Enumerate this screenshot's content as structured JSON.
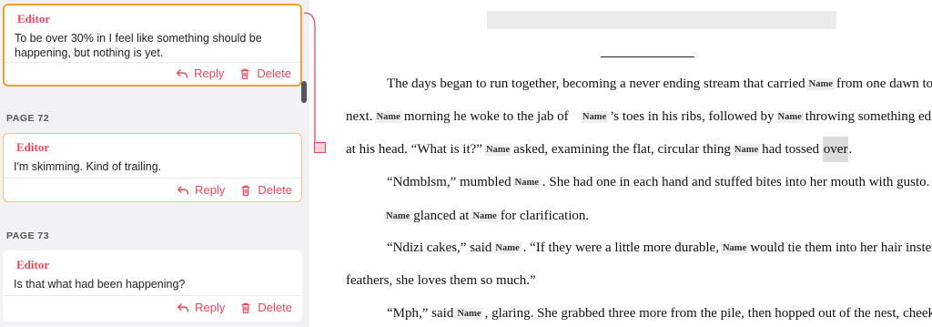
{
  "sidebar": {
    "comments": [
      {
        "role": "Editor",
        "text": "To be over 30% in I feel like something should be happening, but nothing is yet.",
        "reply_label": "Reply",
        "delete_label": "Delete"
      },
      {
        "page_label": "PAGE 72",
        "role": "Editor",
        "text": "I'm skimming. Kind of trailing.",
        "reply_label": "Reply",
        "delete_label": "Delete"
      },
      {
        "page_label": "PAGE 73",
        "role": "Editor",
        "text": "Is that what had been happening?",
        "reply_label": "Reply",
        "delete_label": "Delete"
      }
    ]
  },
  "document": {
    "name_token": "Name",
    "lines": {
      "l1a": "The days began to run together, becoming a never ending stream that carried",
      "l1b": "from one dawn to th",
      "l2a": "next.",
      "l2b": "morning he woke to the jab of",
      "l2c": "’s toes in his ribs, followed by",
      "l2d": "throwing something edib",
      "l3a": "at his head. “What is it?”",
      "l3b": "asked, examining the flat, circular thing",
      "l3c": "had tossed",
      "l3d": "over",
      "l3e": ".",
      "l4a": "“Ndmblsm,” mumbled",
      "l4b": ". She had one in each hand and stuffed bites into her mouth with gusto.",
      "l5a": "glanced at",
      "l5b": "for clarification.",
      "l6a": "“Ndizi cakes,” said",
      "l6b": ". “If they were a little more durable,",
      "l6c": "would tie them into her hair instead",
      "l7": "feathers, she loves them so much.”",
      "l8a": "“Mph,” said",
      "l8b": ", glaring. She grabbed three more from the pile, then hopped out of the nest, cheeks"
    }
  },
  "colors": {
    "accent": "#e8475e",
    "active_border": "#f0a030",
    "sidebar_bg": "#f2f2f4"
  }
}
